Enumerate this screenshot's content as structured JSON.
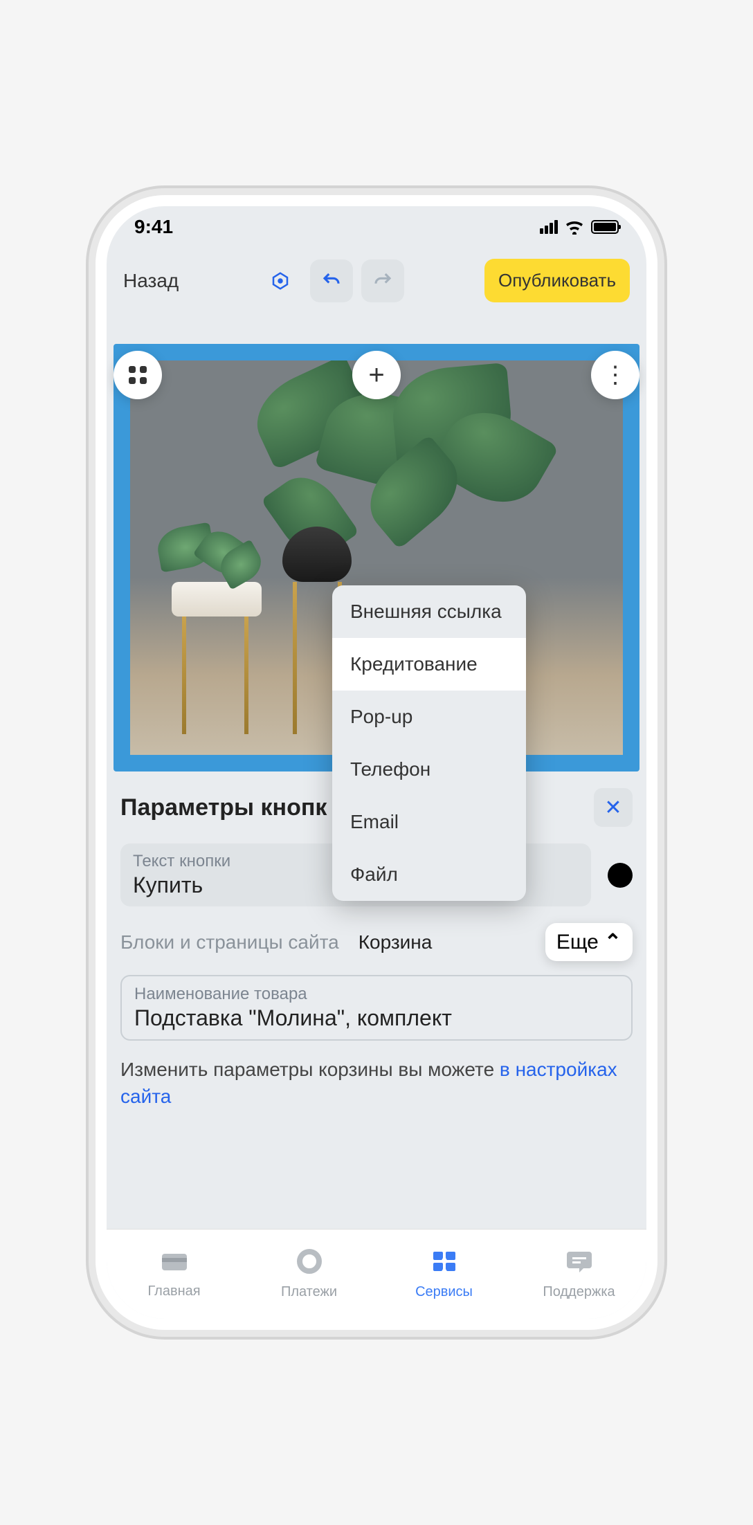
{
  "status": {
    "time": "9:41"
  },
  "header": {
    "back": "Назад",
    "publish": "Опубликовать"
  },
  "panel": {
    "title": "Параметры кнопк",
    "button_text_label": "Текст кнопки",
    "button_text_value": "Купить",
    "tabs": [
      "Блоки и страницы сайта",
      "Корзина"
    ],
    "more": "Еще",
    "product_label": "Наименование товара",
    "product_value": "Подставка \"Молина\", комплект",
    "help_prefix": "Изменить параметры корзины вы можете ",
    "help_link": "в настройках сайта"
  },
  "dropdown": {
    "items": [
      "Внешняя ссылка",
      "Кредитование",
      "Pop-up",
      "Телефон",
      "Email",
      "Файл"
    ],
    "selected_index": 1
  },
  "tabbar": {
    "items": [
      {
        "label": "Главная"
      },
      {
        "label": "Платежи"
      },
      {
        "label": "Сервисы"
      },
      {
        "label": "Поддержка"
      }
    ],
    "active_index": 2
  }
}
